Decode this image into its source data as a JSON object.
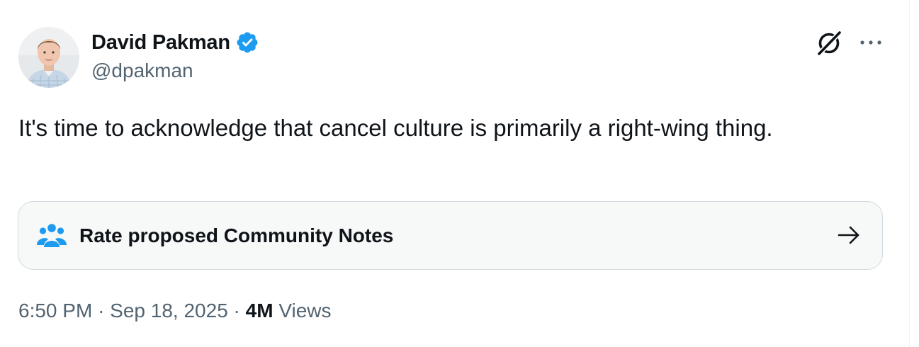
{
  "author": {
    "display_name": "David Pakman",
    "handle": "@dpakman",
    "verified": true
  },
  "tweet": {
    "text": "It's time to acknowledge that cancel culture is primarily a right-wing thing."
  },
  "community_notes": {
    "label": "Rate proposed Community Notes"
  },
  "meta": {
    "time": "6:50 PM",
    "separator": "·",
    "date": "Sep 18, 2025",
    "views_count": "4M",
    "views_label": "Views"
  },
  "colors": {
    "text_primary": "#0f1419",
    "text_secondary": "#536471",
    "verified_blue": "#1d9bf0",
    "card_border": "#cfd9de",
    "card_background": "#f7f8f8"
  },
  "icons": {
    "verified": "verified-badge-icon",
    "grok": "grok-icon",
    "more": "more-options-icon",
    "notes": "community-notes-icon",
    "arrow": "arrow-right-icon"
  }
}
